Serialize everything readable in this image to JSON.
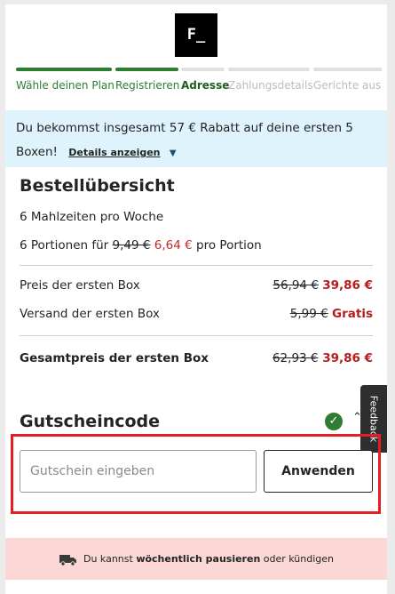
{
  "logo": {
    "text": "F_"
  },
  "steps": [
    {
      "label": "Wähle deinen Plan",
      "state": "done"
    },
    {
      "label": "Registrieren",
      "state": "done"
    },
    {
      "label": "Adresse",
      "state": "current"
    },
    {
      "label": "Zahlungsdetails",
      "state": "upcoming"
    },
    {
      "label": "Gerichte aus",
      "state": "upcoming"
    }
  ],
  "promo": {
    "text": "Du bekommst insgesamt 57 € Rabatt auf deine ersten 5 Boxen!",
    "details_label": "Details anzeigen",
    "chevron_icon": "chevron-down-icon"
  },
  "summary": {
    "title": "Bestellübersicht",
    "meals": "6 Mahlzeiten pro Woche",
    "portions_prefix": "6 Portionen für",
    "portion_old": "9,49 €",
    "portion_new": "6,64 €",
    "portions_suffix": "pro Portion",
    "first_box_label": "Preis der ersten Box",
    "first_box_old": "56,94 €",
    "first_box_new": "39,86 €",
    "shipping_label": "Versand der ersten Box",
    "shipping_old": "5,99 €",
    "shipping_new": "Gratis",
    "total_label": "Gesamtpreis der ersten Box",
    "total_old": "62,93 €",
    "total_new": "39,86 €"
  },
  "voucher": {
    "title": "Gutscheincode",
    "placeholder": "Gutschein eingeben",
    "value": "",
    "apply_label": "Anwenden"
  },
  "feedback": {
    "label": "Feedback"
  },
  "footer": {
    "prefix": "Du kannst",
    "bold": "wöchentlich pausieren",
    "suffix": "oder kündigen",
    "icon": "truck-icon"
  },
  "colors": {
    "brand_green": "#2f7d32",
    "price_red": "#c62828",
    "promo_bg": "#def3fb",
    "footer_bg": "#fbd8d5",
    "highlight": "#e31e24"
  }
}
